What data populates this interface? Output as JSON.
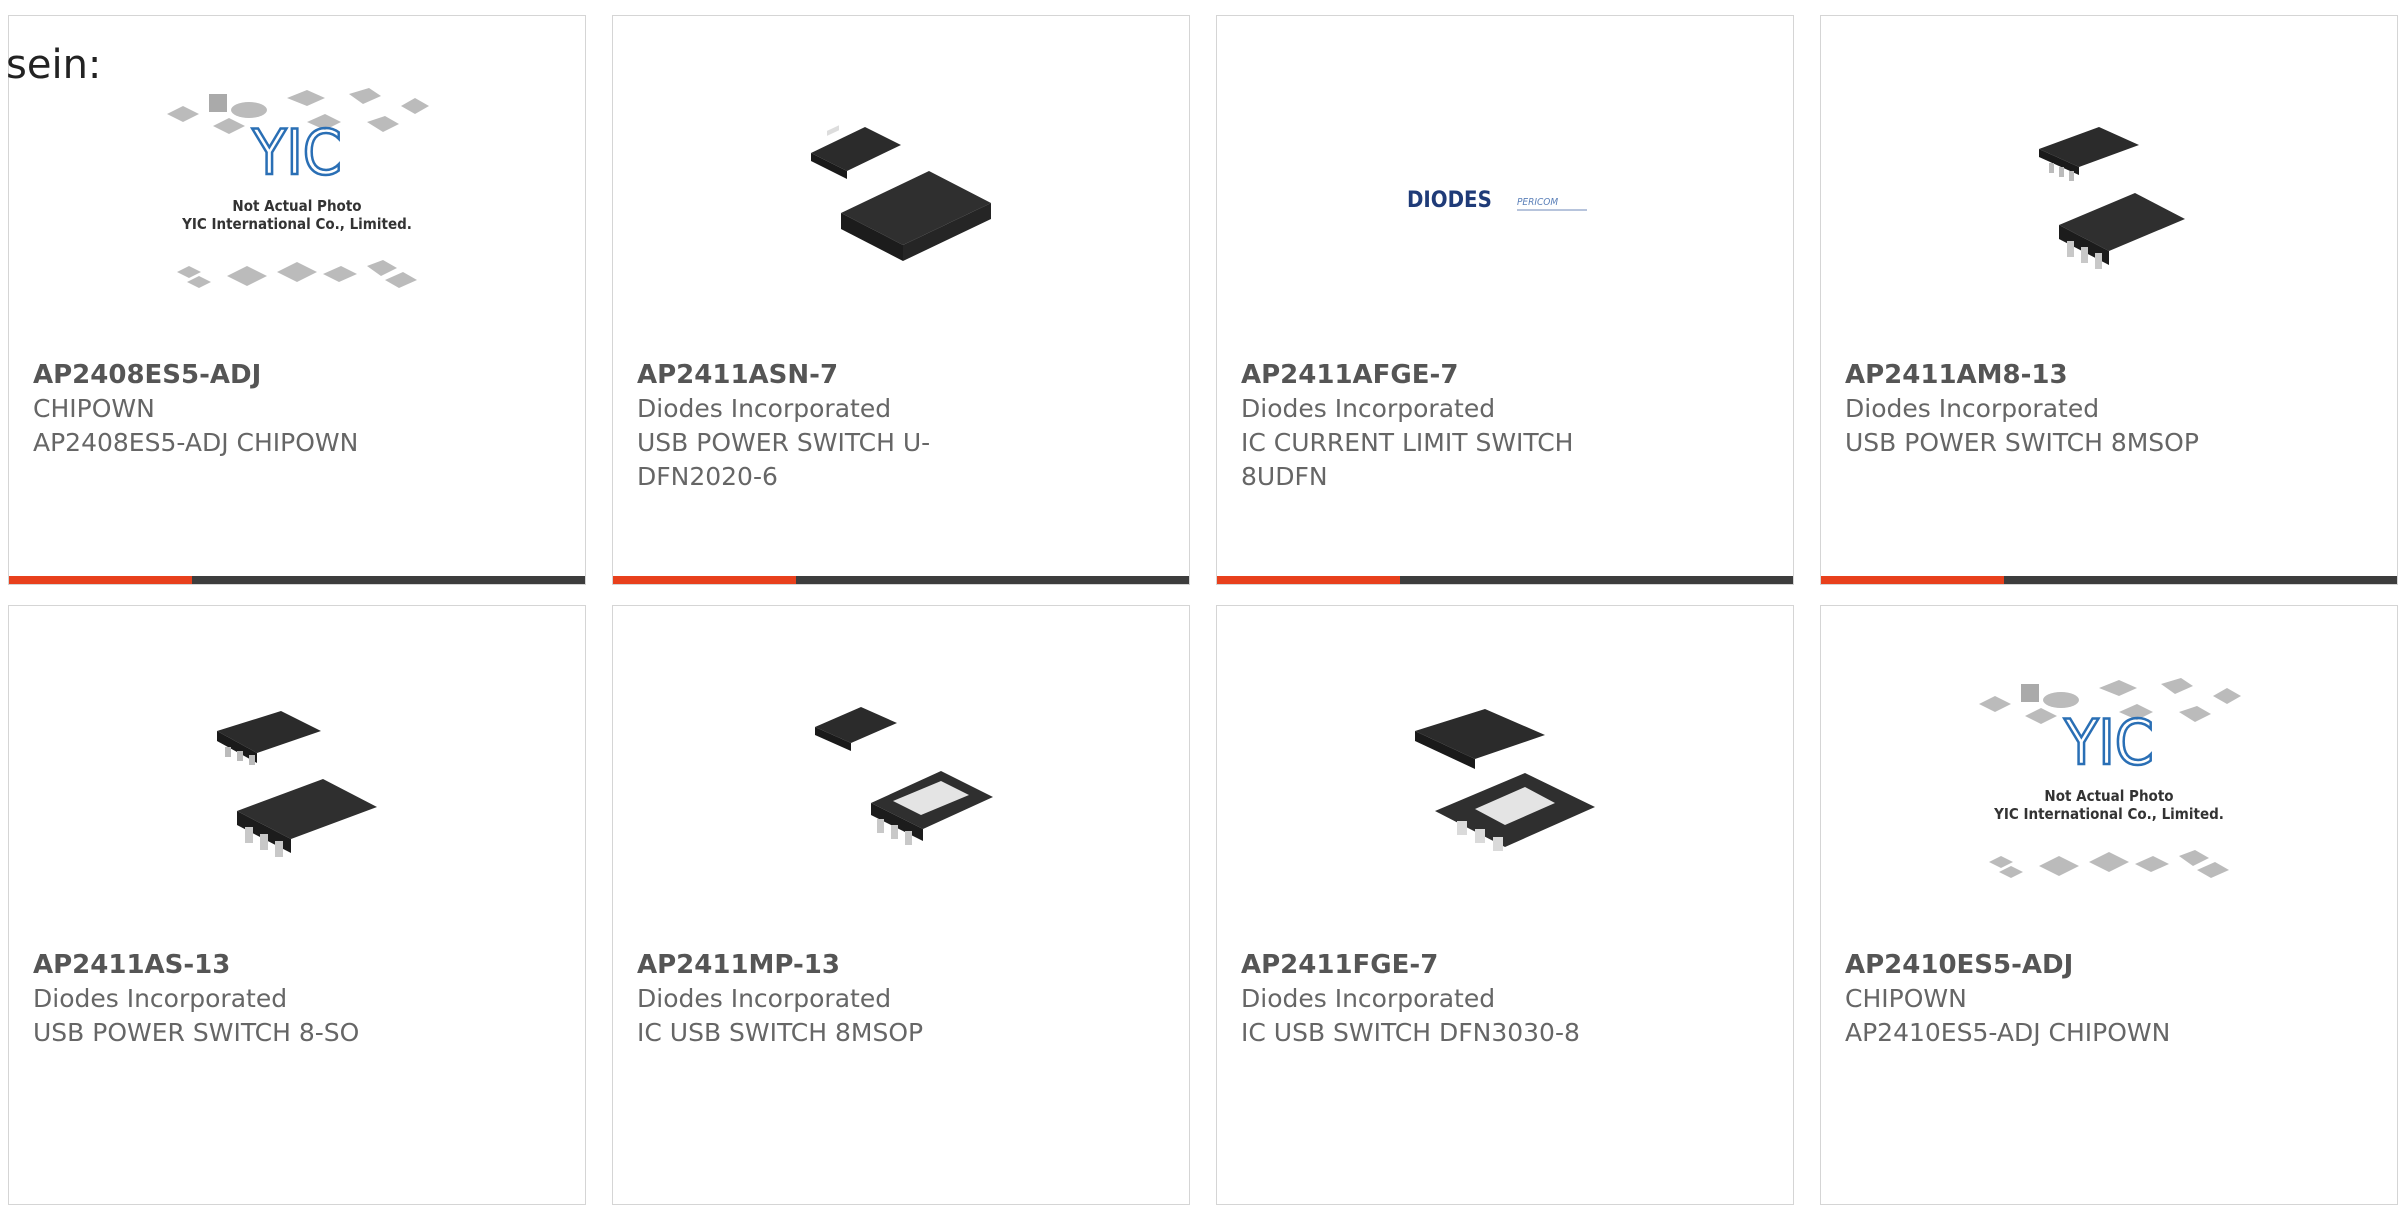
{
  "lead_text": "sein:",
  "placeholder_caption": [
    "Not Actual Photo",
    "YIC International Co., Limited."
  ],
  "placeholder_logo": "YIC",
  "diodes_logo": {
    "brand": "DIODES",
    "sub": "PERICOM"
  },
  "colors": {
    "accent": "#e8401c",
    "bar": "#3d3d3d",
    "chip": "#2b2b2b",
    "border": "#d5d5d5"
  },
  "products": [
    {
      "part": "AP2408ES5-ADJ",
      "mfr": "CHIPOWN",
      "desc": "AP2408ES5-ADJ CHIPOWN",
      "image": "yic-placeholder"
    },
    {
      "part": "AP2411ASN-7",
      "mfr": "Diodes Incorporated",
      "desc": "USB POWER SWITCH U-DFN2020-6",
      "image": "dfn-chip"
    },
    {
      "part": "AP2411AFGE-7",
      "mfr": "Diodes Incorporated",
      "desc": "IC CURRENT LIMIT SWITCH 8UDFN",
      "image": "diodes-logo"
    },
    {
      "part": "AP2411AM8-13",
      "mfr": "Diodes Incorporated",
      "desc": "USB POWER SWITCH 8MSOP",
      "image": "msop-chip"
    },
    {
      "part": "AP2411AS-13",
      "mfr": "Diodes Incorporated",
      "desc": "USB POWER SWITCH 8-SO",
      "image": "so-chip"
    },
    {
      "part": "AP2411MP-13",
      "mfr": "Diodes Incorporated",
      "desc": "IC USB SWITCH 8MSOP",
      "image": "msop-pad-chip"
    },
    {
      "part": "AP2411FGE-7",
      "mfr": "Diodes Incorporated",
      "desc": "IC USB SWITCH DFN3030-8",
      "image": "dfn8-chip"
    },
    {
      "part": "AP2410ES5-ADJ",
      "mfr": "CHIPOWN",
      "desc": "AP2410ES5-ADJ CHIPOWN",
      "image": "yic-placeholder"
    }
  ]
}
